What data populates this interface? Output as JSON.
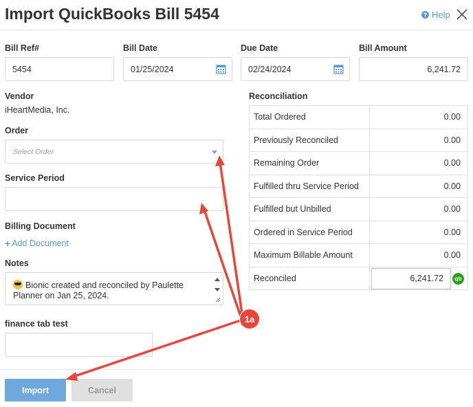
{
  "header": {
    "title": "Import QuickBooks Bill 5454",
    "help_label": "Help"
  },
  "form": {
    "bill_ref": {
      "label": "Bill Ref#",
      "value": "5454"
    },
    "bill_date": {
      "label": "Bill Date",
      "value": "01/25/2024"
    },
    "due_date": {
      "label": "Due Date",
      "value": "02/24/2024"
    },
    "bill_amount": {
      "label": "Bill Amount",
      "value": "6,241.72"
    },
    "vendor": {
      "label": "Vendor",
      "value": "iHeartMedia, Inc."
    },
    "order": {
      "label": "Order",
      "placeholder": "Select Order"
    },
    "service_period": {
      "label": "Service Period",
      "value": ""
    },
    "billing_document": {
      "label": "Billing Document",
      "add_label": "Add Document"
    },
    "notes": {
      "label": "Notes",
      "value": "Bionic created and reconciled by Paulette Planner on Jan 25, 2024."
    },
    "finance_tab_test": {
      "label": "finance tab test",
      "value": ""
    }
  },
  "reconciliation": {
    "label": "Reconciliation",
    "rows": [
      {
        "label": "Total Ordered",
        "value": "0.00"
      },
      {
        "label": "Previously Reconciled",
        "value": "0.00"
      },
      {
        "label": "Remaining Order",
        "value": "0.00"
      },
      {
        "label": "Fulfilled thru Service Period",
        "value": "0.00"
      },
      {
        "label": "Fulfilled but Unbilled",
        "value": "0.00"
      },
      {
        "label": "Ordered in Service Period",
        "value": "0.00"
      },
      {
        "label": "Maximum Billable Amount",
        "value": "0.00"
      }
    ],
    "reconciled": {
      "label": "Reconciled",
      "value": "6,241.72",
      "badge": "qb"
    }
  },
  "footer": {
    "import_label": "Import",
    "cancel_label": "Cancel"
  },
  "annotation": {
    "badge_label": "1a",
    "color": "#e8463a"
  },
  "colors": {
    "link": "#5b9bd5",
    "primary_button": "#6fa8dc",
    "quickbooks_green": "#2ca01c"
  }
}
